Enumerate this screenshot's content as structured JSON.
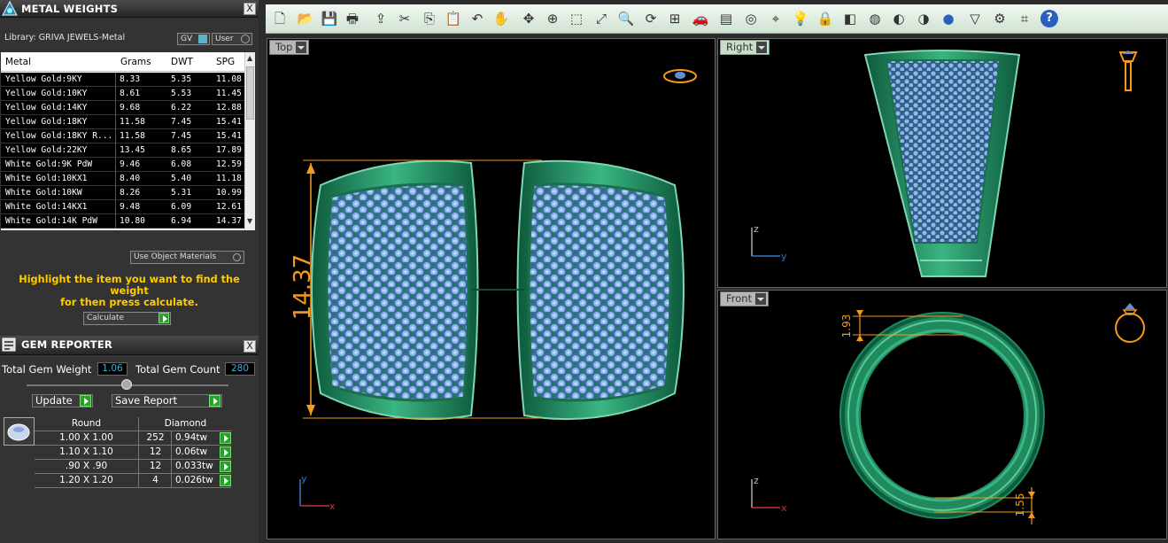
{
  "metal_weights": {
    "title": "METAL WEIGHTS",
    "close": "X",
    "library": "Library: GRIVA JEWELS-Metal",
    "toggle_gv": "GV",
    "toggle_user": "User",
    "columns": [
      "Metal",
      "Grams",
      "DWT",
      "SPG"
    ],
    "rows": [
      [
        "Yellow Gold:9KY",
        "8.33",
        "5.35",
        "11.08"
      ],
      [
        "Yellow Gold:10KY",
        "8.61",
        "5.53",
        "11.45"
      ],
      [
        "Yellow Gold:14KY",
        "9.68",
        "6.22",
        "12.88"
      ],
      [
        "Yellow Gold:18KY",
        "11.58",
        "7.45",
        "15.41"
      ],
      [
        "Yellow Gold:18KY R...",
        "11.58",
        "7.45",
        "15.41"
      ],
      [
        "Yellow Gold:22KY",
        "13.45",
        "8.65",
        "17.89"
      ],
      [
        "White Gold:9K PdW",
        "9.46",
        "6.08",
        "12.59"
      ],
      [
        "White Gold:10KX1",
        "8.40",
        "5.40",
        "11.18"
      ],
      [
        "White Gold:10KW",
        "8.26",
        "5.31",
        "10.99"
      ],
      [
        "White Gold:14KX1",
        "9.48",
        "6.09",
        "12.61"
      ],
      [
        "White Gold:14K PdW",
        "10.80",
        "6.94",
        "14.37"
      ]
    ],
    "use_object_materials": "Use Object Materials",
    "help_line1": "Highlight the item you want to find the weight",
    "help_line2": "for then press calculate.",
    "calculate": "Calculate"
  },
  "gem_reporter": {
    "title": "GEM REPORTER",
    "close": "X",
    "total_weight_label": "Total Gem Weight",
    "total_weight": "1.06",
    "total_count_label": "Total Gem Count",
    "total_count": "280",
    "update": "Update",
    "save_report": "Save Report",
    "shape": "Round",
    "stone": "Diamond",
    "rows": [
      [
        "1.00 X 1.00",
        "252",
        "0.94tw"
      ],
      [
        "1.10 X 1.10",
        "12",
        "0.06tw"
      ],
      [
        ".90 X .90",
        "12",
        "0.033tw"
      ],
      [
        "1.20 X 1.20",
        "4",
        "0.026tw"
      ]
    ]
  },
  "toolbar": {
    "icons": [
      "new-icon",
      "open-icon",
      "save-icon",
      "print-icon",
      "export-icon",
      "cut-icon",
      "copy-icon",
      "paste-icon",
      "undo-icon",
      "pan-hand-icon",
      "move-icon",
      "zoom-in-icon",
      "zoom-window-icon",
      "zoom-extents-icon",
      "zoom-selected-icon",
      "rotate-view-icon",
      "four-views-icon",
      "car-icon",
      "layer-icon",
      "snap-icon",
      "object-snap-icon",
      "light-bulb-icon",
      "lock-icon",
      "material-icon",
      "color-wheel-icon",
      "shade-icon",
      "render-icon",
      "sphere-icon",
      "cone-icon",
      "settings-gear-icon",
      "transform-icon",
      "help-icon"
    ]
  },
  "viewports": {
    "top": {
      "label": "Top",
      "dimension": "14.37",
      "axis_x": "x",
      "axis_y": "y"
    },
    "right": {
      "label": "Right",
      "axis_x": "y",
      "axis_y": "z"
    },
    "front": {
      "label": "Front",
      "dim_top": "1.93",
      "dim_bottom": "1.55",
      "axis_x": "x",
      "axis_y": "z"
    }
  },
  "colors": {
    "metal": "#1f8a5e",
    "gem": "#8fb5ef",
    "dimension": "#f59a1a",
    "toolbar": "#d6e8d8"
  }
}
